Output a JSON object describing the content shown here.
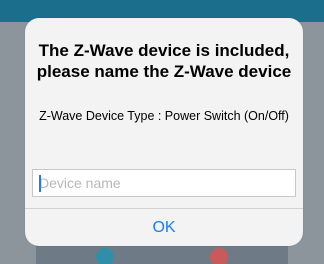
{
  "dialog": {
    "title": "The Z-Wave device is included, please name the Z-Wave device",
    "message": "Z-Wave Device Type : Power Switch (On/Off)",
    "input": {
      "value": "",
      "placeholder": "Device name"
    },
    "ok_label": "OK"
  },
  "colors": {
    "accent": "#1a7cf5",
    "dialog_bg": "#f3f3f3",
    "caret": "#2a7ad6"
  }
}
